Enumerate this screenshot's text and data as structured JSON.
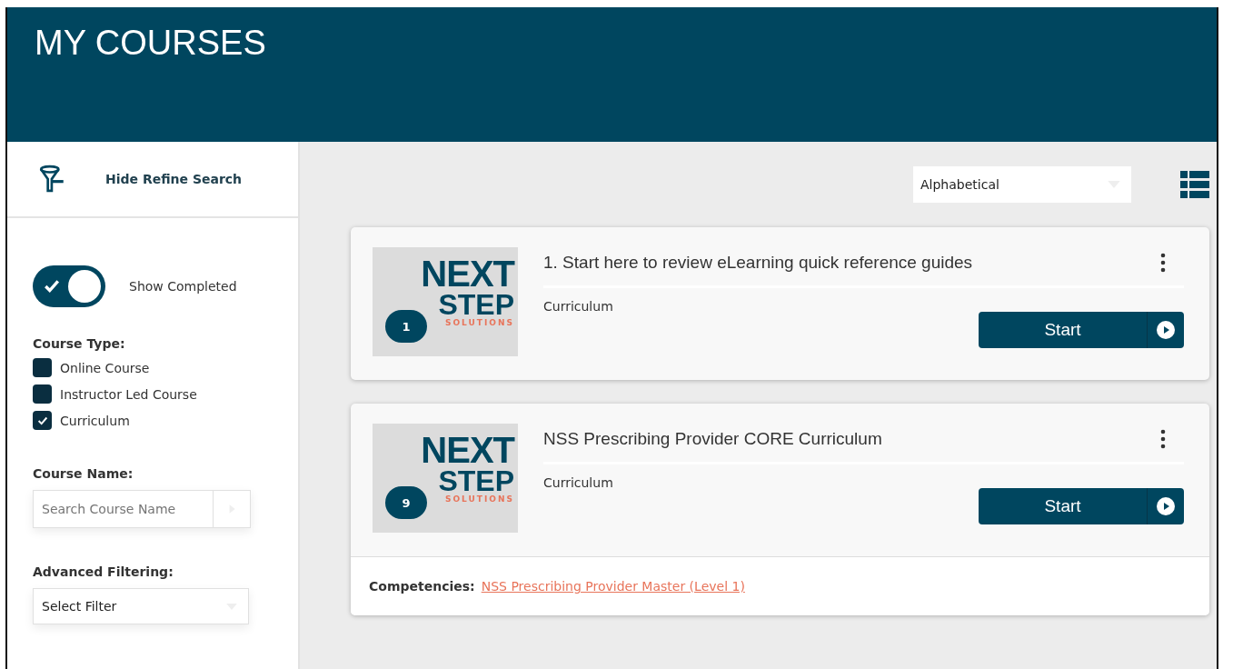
{
  "header": {
    "title": "MY COURSES"
  },
  "sidebar": {
    "toggle_link": "Hide Refine Search",
    "show_completed": {
      "label": "Show Completed",
      "on": true
    },
    "course_type": {
      "label": "Course Type:",
      "options": [
        {
          "label": "Online Course",
          "checked": false
        },
        {
          "label": "Instructor Led Course",
          "checked": false
        },
        {
          "label": "Curriculum",
          "checked": true
        }
      ]
    },
    "course_name": {
      "label": "Course Name:",
      "placeholder": "Search Course Name"
    },
    "advanced_filtering": {
      "label": "Advanced Filtering:",
      "value": "Select Filter"
    }
  },
  "sort": {
    "value": "Alphabetical"
  },
  "courses": [
    {
      "logo": {
        "line_1": "NEXT",
        "line_2": "STEP",
        "tagline": "SOLUTIONS"
      },
      "count": "1",
      "title": "1. Start here to review eLearning quick reference guides",
      "type": "Curriculum",
      "button": "Start"
    },
    {
      "logo": {
        "line_1": "NEXT",
        "line_2": "STEP",
        "tagline": "SOLUTIONS"
      },
      "count": "9",
      "title": "NSS Prescribing Provider CORE Curriculum",
      "type": "Curriculum",
      "button": "Start",
      "competencies": {
        "label": "Competencies:",
        "link": "NSS Prescribing Provider Master (Level 1)"
      }
    }
  ]
}
